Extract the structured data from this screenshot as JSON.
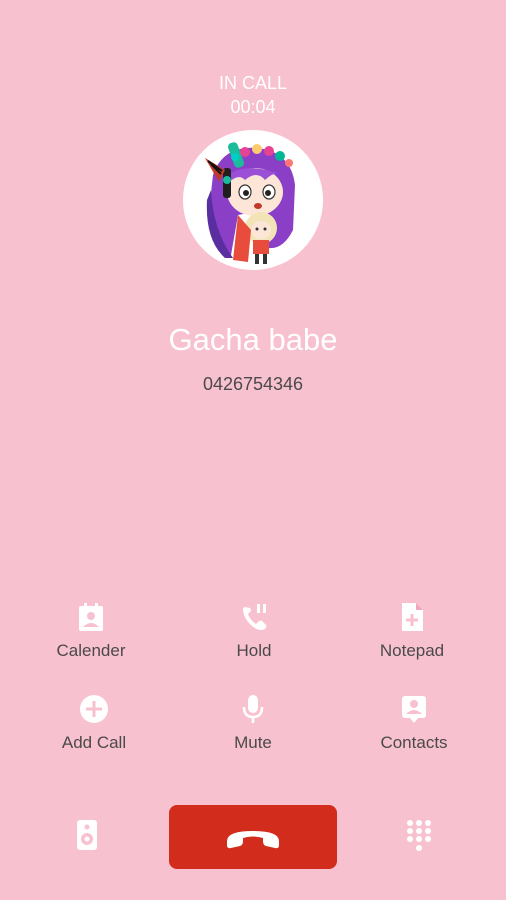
{
  "call": {
    "status": "IN CALL",
    "duration": "00:04",
    "caller_name": "Gacha babe",
    "caller_number": "0426754346"
  },
  "actions": [
    {
      "label": "Calender",
      "icon": "calendar-contact-icon"
    },
    {
      "label": "Hold",
      "icon": "phone-pause-icon"
    },
    {
      "label": "Notepad",
      "icon": "note-add-icon"
    },
    {
      "label": "Add Call",
      "icon": "add-circle-icon"
    },
    {
      "label": "Mute",
      "icon": "microphone-icon"
    },
    {
      "label": "Contacts",
      "icon": "contacts-icon"
    }
  ],
  "bottom_bar": {
    "speaker_icon": "speaker-icon",
    "end_call_icon": "end-call-icon",
    "dialpad_icon": "dialpad-icon"
  },
  "colors": {
    "background": "#f8c1d0",
    "end_call": "#d12c1c",
    "text_light": "#ffffff",
    "text_dark": "#4a4a4a"
  }
}
